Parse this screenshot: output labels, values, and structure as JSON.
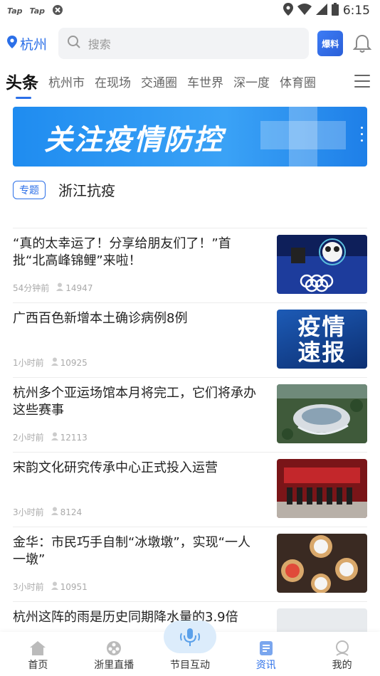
{
  "status_bar": {
    "app_badges": [
      "Tap",
      "Tap"
    ],
    "time": "6:15"
  },
  "header": {
    "city": "杭州",
    "search_placeholder": "搜索",
    "baoliao_label": "爆料"
  },
  "tabs": [
    "头条",
    "杭州市",
    "在现场",
    "交通圈",
    "车世界",
    "深一度",
    "体育圈"
  ],
  "banner": {
    "text": "关注疫情防控"
  },
  "topic": {
    "tag": "专题",
    "title": "浙江抗疫"
  },
  "news": [
    {
      "title": "“真的太幸运了！分享给朋友们了！”首批“北高峰锦鲤”来啦！",
      "time": "54分钟前",
      "views": "14947",
      "thumb": "olympics"
    },
    {
      "title": "广西百色新增本土确诊病例8例",
      "time": "1小时前",
      "views": "10925",
      "thumb": "report"
    },
    {
      "title": "杭州多个亚运场馆本月将完工，它们将承办这些赛事",
      "time": "2小时前",
      "views": "12113",
      "thumb": "stadium"
    },
    {
      "title": "宋韵文化研究传承中心正式投入运营",
      "time": "3小时前",
      "views": "8124",
      "thumb": "ceremony"
    },
    {
      "title": "金华：市民巧手自制“冰墩墩”，实现“一人一墩”",
      "time": "3小时前",
      "views": "10951",
      "thumb": "dumplings"
    },
    {
      "title": "杭州这阵的雨是历史同期降水量的3.9倍",
      "time": "",
      "views": "",
      "thumb": "painting"
    }
  ],
  "thumb_text": {
    "report": "疫情速报"
  },
  "bottom_nav": [
    {
      "label": "首页",
      "icon": "home-icon"
    },
    {
      "label": "浙里直播",
      "icon": "film-icon"
    },
    {
      "label": "节目互动",
      "icon": "mic-icon"
    },
    {
      "label": "资讯",
      "icon": "news-icon",
      "active": true
    },
    {
      "label": "我的",
      "icon": "user-icon"
    }
  ],
  "colors": {
    "accent": "#2b6fe8",
    "banner": "#1f8cf0"
  }
}
